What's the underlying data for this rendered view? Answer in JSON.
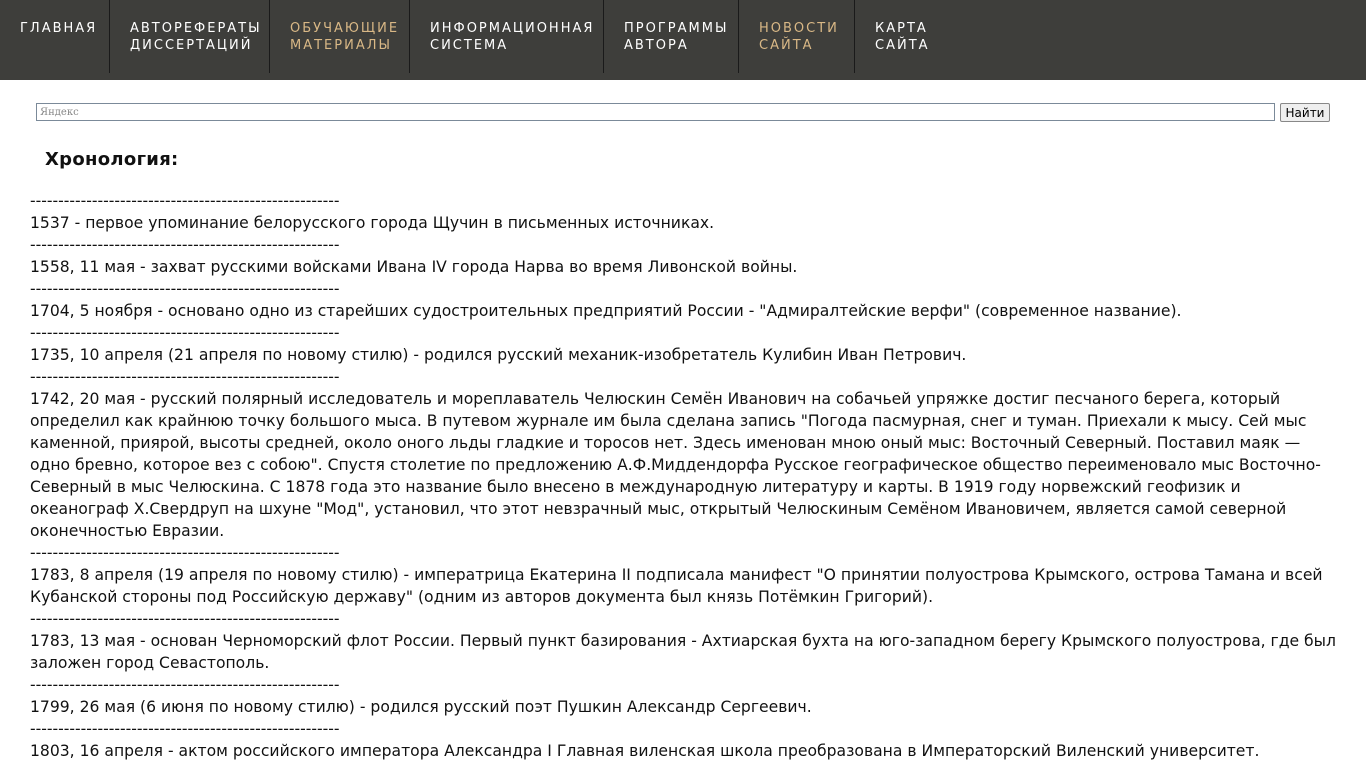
{
  "nav": [
    {
      "line1": "ГЛАВНАЯ",
      "line2": ""
    },
    {
      "line1": "АВТОРЕФЕРАТЫ",
      "line2": "ДИССЕРТАЦИЙ"
    },
    {
      "line1": "ОБУЧАЮЩИЕ",
      "line2": "МАТЕРИАЛЫ"
    },
    {
      "line1": "ИНФОРМАЦИОННАЯ",
      "line2": "СИСТЕМА"
    },
    {
      "line1": "ПРОГРАММЫ",
      "line2": "АВТОРА"
    },
    {
      "line1": "НОВОСТИ",
      "line2": "САЙТА"
    },
    {
      "line1": "КАРТА",
      "line2": "САЙТА"
    }
  ],
  "colors": {
    "nav_bg": "#3e3e3b",
    "nav_text": "#ffffff",
    "nav_accent": "#d9b886"
  },
  "search": {
    "placeholder": "Яндекс",
    "value": "",
    "button": "Найти"
  },
  "page_title": "Хронология:",
  "divider": "-------------------------------------------------------",
  "entries": [
    "1537 - первое упоминание белорусского города Щучин в письменных источниках.",
    "1558, 11 мая - захват русскими войсками Ивана IV города Нарва во время Ливонской войны.",
    "1704, 5 ноября - основано одно из старейших судостроительных предприятий России - \"Адмиралтейские верфи\" (современное название).",
    "1735, 10 апреля (21 апреля по новому стилю) - родился русский механик-изобретатель Кулибин Иван Петрович.",
    "1742, 20 мая - русский полярный исследователь и мореплаватель Челюскин Семён Иванович на собачьей упряжке достиг песчаного берега, который определил как крайнюю точку большого мыса. В путевом журнале им была сделана запись \"Погода пасмурная, снег и туман. Приехали к мысу. Сей мыс каменной, приярой, высоты средней, около оного льды гладкие и торосов нет. Здесь именован мною оный мыс: Восточный Северный. Поставил маяк — одно бревно, которое вез с собою\". Спустя столетие по предложению А.Ф.Миддендорфа Русское географическое общество переименовало мыс Восточно-Северный в мыс Челюскина. С 1878 года это название было внесено в международную литературу и карты. В 1919 году норвежский геофизик и океанограф Х.Свердруп на шхуне \"Мод\", установил, что этот невзрачный мыс, открытый Челюскиным Семёном Ивановичем, является самой северной оконечностью Евразии.",
    "1783, 8 апреля (19 апреля по новому стилю) - императрица Екатерина II подписала манифест \"О принятии полуострова Крымского, острова Тамана и всей Кубанской стороны под Российскую державу\" (одним из авторов документа был князь Потёмкин Григорий).",
    "1783, 13 мая - основан Черноморский флот России. Первый пункт базирования - Ахтиарская бухта на юго-западном берегу Крымского полуострова, где был заложен город Севастополь.",
    "1799, 26 мая (6 июня по новому стилю) - родился русский поэт Пушкин Александр Сергеевич.",
    "1803, 16 апреля - актом российского императора Александра I Главная виленская школа преобразована в Императорский Виленский университет."
  ]
}
